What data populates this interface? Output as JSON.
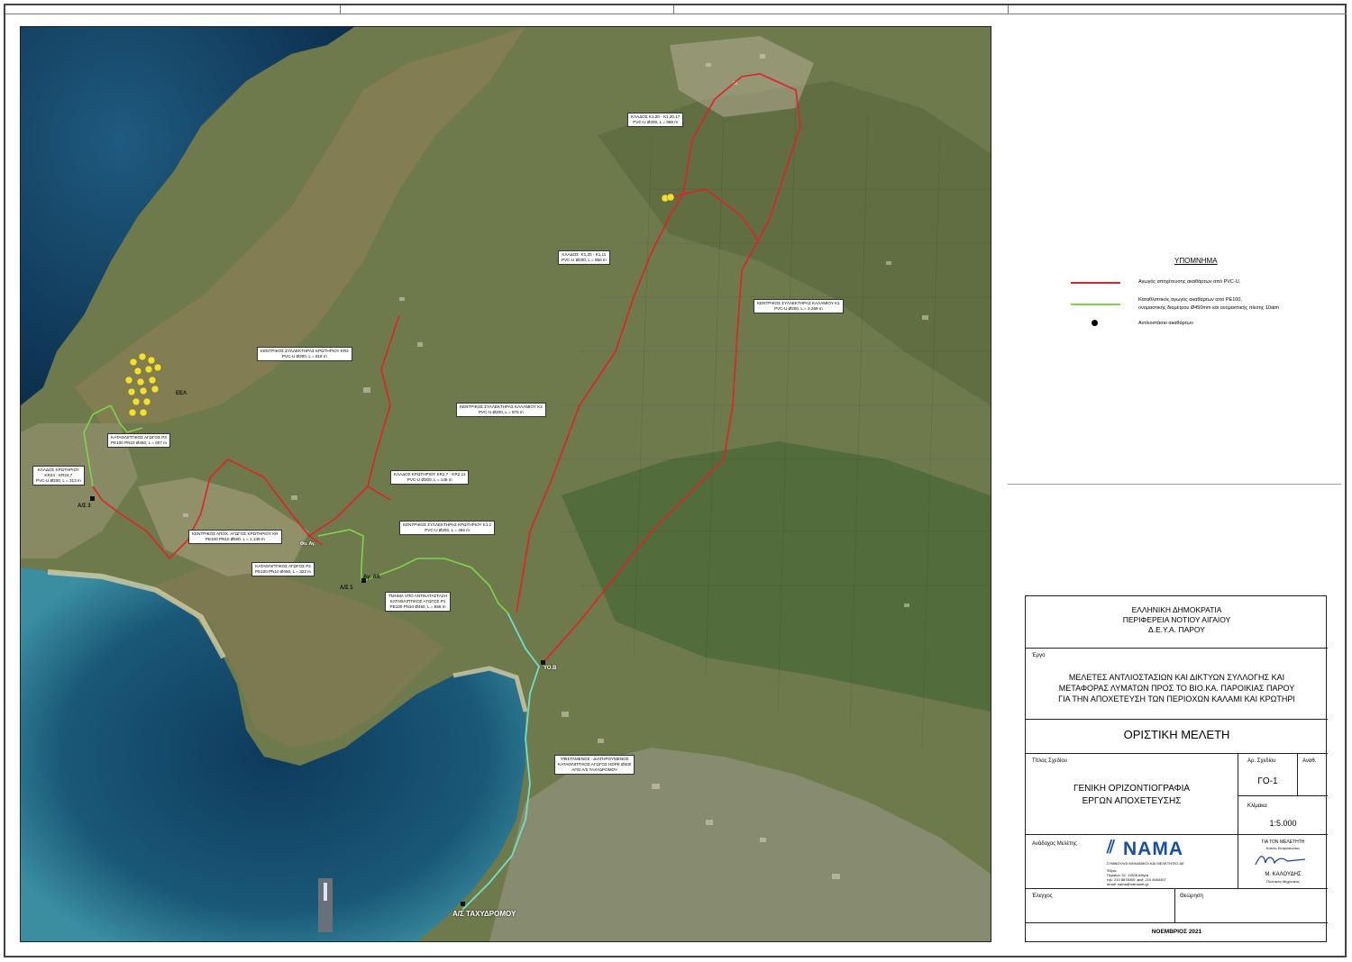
{
  "legend": {
    "title": "ΥΠΟΜΝΗΜΑ",
    "items": [
      {
        "text": "Αγωγός αποχέτευσης ακαθάρτων από PVC-U,",
        "color": "#e0202a",
        "kind": "line"
      },
      {
        "text": "Καταθλιπτικός αγωγός ακαθάρτων από PE100,",
        "text2": "ονομαστικής διαμέτρου Ø450mm και ονομαστικής πίεσης 10atm",
        "color": "#7fd44a",
        "kind": "line"
      },
      {
        "text": "Αντλιοστάσιο ακαθάρτων",
        "color": "#000000",
        "kind": "dot"
      }
    ]
  },
  "map": {
    "callouts": [
      {
        "id": "k1-20",
        "lines": [
          "ΚΛΑΔΟΣ Κ1,20 - Κ1,20,17",
          "PVC-U Ø200, L = 969 m"
        ]
      },
      {
        "id": "k1-20-k1-11",
        "lines": [
          "ΚΛΑΔΟΣ  Κ1,20 - Κ1,11",
          "PVC-U Ø200, L = 550 m"
        ]
      },
      {
        "id": "kentrikos-k1",
        "lines": [
          "ΚΕΝΤΡΙΚΟΣ ΣΥΛΛΕΚΤΗΡΑΣ ΚΑΛΑΜΙΟΥ Κ1",
          "PVC-U Ø200, L = 3,269 m"
        ]
      },
      {
        "id": "kentrikos-kr2",
        "lines": [
          "ΚΕΝΤΡΙΚΟΣ ΣΥΛΛΕΚΤΗΡΑΣ ΚΡΩΤΗΡΙΟΥ ΚR2",
          "PVC-U Ø200, L = 818 m"
        ]
      },
      {
        "id": "kentrikos-k3",
        "lines": [
          "ΚΕΝΤΡΙΚΟΣ ΣΥΛΛΕΚΤΗΡΑΣ ΚΑΛΑΜΙΟΥ Κ3",
          "PVC-U Ø200, L = 876 m"
        ]
      },
      {
        "id": "kataktp3",
        "lines": [
          "ΚΑΤΑΘΛΙΠΤΙΚΟΣ ΑΓΩΓΟΣ Ρ3",
          "PE100 PN10 Ø450, L = 607 m"
        ]
      },
      {
        "id": "klados-kr24",
        "lines": [
          "ΚΛΑΔΟΣ ΚΡΩΤΗΡΙΟΥ",
          "ΚR24 - ΚR24,7",
          "PVC-U Ø200, L = 313 m"
        ]
      },
      {
        "id": "klados-kr2-7",
        "lines": [
          "ΚΛΑΔΟΣ ΚΡΩΤΗΡΙΟΥ ΚR2,7 - ΚR2,11",
          "PVC-U Ø200, L = 148 m"
        ]
      },
      {
        "id": "kentrikos-k1-1",
        "lines": [
          "ΚΕΝΤΡΙΚΟΣ ΣΥΛΛΕΚΤΗΡΑΣ ΚΡΩΤΗΡΙΟΥ Κ1,1",
          "PVC-U Ø200, L = 456 m"
        ]
      },
      {
        "id": "kentrikos-kr",
        "lines": [
          "ΚΕΝΤΡΙΚΟΣ ΑΠΟΧ. ΑΓΩΓΟΣ ΚΡΩΤΗΡΙΟΥ ΚR",
          "PE100 PN10 Ø500, L = 1,149 m"
        ]
      },
      {
        "id": "katakt-p2",
        "lines": [
          "ΚΑΤΑΘΛΙΠΤΙΚΟΣ ΑΓΩΓΟΣ Ρ2",
          "PE100 PN10 Ø450, L = 322 m"
        ]
      },
      {
        "id": "tmima-p1",
        "lines": [
          "ΤΜΗΜΑ ΥΠΟ ΑΝΤΙΚΑΤΑΣΤΑΣΗ",
          "ΚΑΤΑΘΛΙΠΤΙΚΟΣ ΑΓΩΓΟΣ Ρ1",
          "PE100 PN10 Ø450, L = 566 m"
        ]
      },
      {
        "id": "yfistamenos",
        "lines": [
          "ΥΦΙΣΤΑΜΕΝΟΣ - ΔΙΑΤΗΡΟΥΜΕΝΟΣ",
          "ΚΑΤΑΘΛΙΠΤΙΚΟΣ ΑΓΩΓΟΣ HDPE Ø400",
          "ΑΠΟ Α/Σ ΤΑΧΥΔΡΟΜΟΥ"
        ]
      }
    ],
    "points": {
      "as3": "Α/Σ 3",
      "as1": "Α/Σ 1",
      "ag": "Αγ. Αθ.",
      "vio": "ΥΟ.Β",
      "taxydromou": "Α/Σ ΤΑΧΥΔΡΟΜΟΥ",
      "deal": "ΕΕΛ",
      "kr": "Φυ. Αγ."
    }
  },
  "title_block": {
    "authority": [
      "ΕΛΛΗΝΙΚΗ ΔΗΜΟΚΡΑΤΙΑ",
      "ΠΕΡΙΦΕΡΕΙΑ ΝΟΤΙΟΥ ΑΙΓΑΙΟΥ",
      "Δ.Ε.Υ.Α. ΠΑΡΟΥ"
    ],
    "project_label": "Έργο",
    "project_lines": [
      "ΜΕΛΕΤΕΣ ΑΝΤΛΙΟΣΤΑΣΙΩΝ ΚΑΙ ΔΙΚΤΥΩΝ ΣΥΛΛΟΓΗΣ ΚΑΙ",
      "ΜΕΤΑΦΟΡΑΣ ΛΥΜΑΤΩΝ ΠΡΟΣ ΤΟ ΒΙΟ.ΚΑ. ΠΑΡΟΙΚΙΑΣ ΠΑΡΟΥ",
      "ΓΙΑ ΤΗΝ ΑΠΟΧΕΤΕΥΣΗ ΤΩΝ ΠΕΡΙΟΧΩΝ ΚΑΛΑΜΙ ΚΑΙ ΚΡΩΤΗΡΙ"
    ],
    "stage": "ΟΡΙΣΤΙΚΗ ΜΕΛΕΤΗ",
    "drawing_title_label": "Τίτλος Σχεδίου",
    "drawing_title": [
      "ΓΕΝΙΚΗ ΟΡΙΖΟΝΤΙΟΓΡΑΦΙΑ",
      "ΕΡΓΩΝ ΑΠΟΧΕΤΕΥΣΗΣ"
    ],
    "drawing_no_label": "Αρ. Σχεδίου",
    "drawing_no": "ΓΟ-1",
    "revision_label": "Αναθ.",
    "scale_label": "Κλίμακα",
    "scale": "1:5.000",
    "contractor_label": "Ανάδοχος Μελέτης",
    "company": "NAMA",
    "company_tagline": "ΣΥΜΒΟΥΛΟΙ ΜΗΧΑΝΙΚΟΙ ΚΑΙ ΜΕΛΕΤΗΤΕΣ ΑΕ",
    "company_address": [
      "Έδρα:",
      "Περαίων 32, 11528 Αθήνα",
      "τηλ: 210 8878400, φαξ: 210 8464457",
      "email: nama@namanet.gr"
    ],
    "for_engineer_label": "ΓΙΑ ΤΟΝ ΜΕΛΕΤΗΤΗ",
    "for_engineer_sub": "Κοινός Εκπρόσωπος",
    "engineer_name": "Μ. ΚΑΛΟΥΔΗΣ",
    "engineer_title": "Πολιτικός Μηχανικός",
    "check_label": "Έλεγχος",
    "approval_label": "Θεώρηση",
    "date": "ΝΟΕΜΒΡΙΟΣ 2021"
  }
}
